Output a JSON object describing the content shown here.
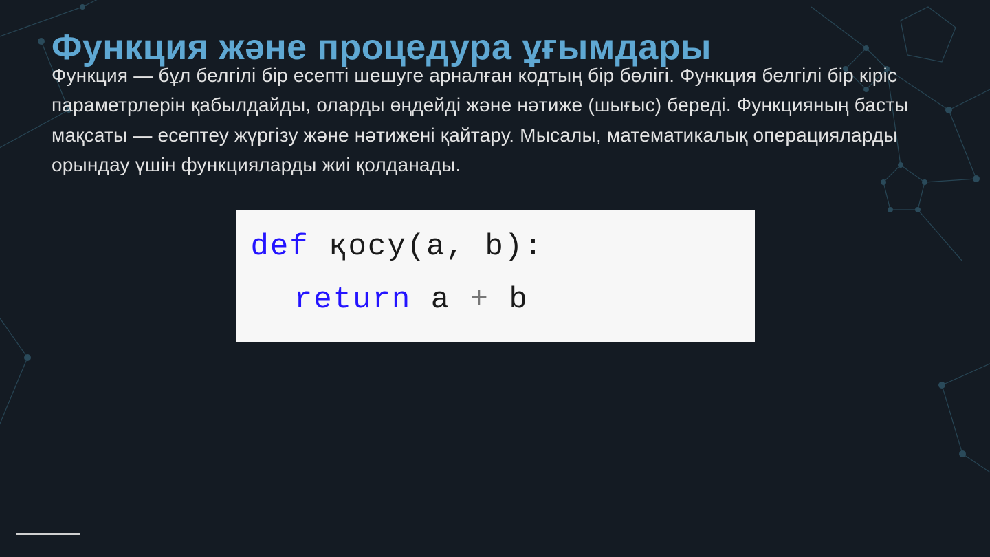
{
  "slide": {
    "title": "Функция және процедура ұғымдары",
    "body": "Функция — бұл белгілі бір есепті шешуге арналған кодтың бір бөлігі. Функция белгілі бір кіріс параметрлерін қабылдайды, оларды өңдейді және нәтиже (шығыс) береді. Функцияның басты мақсаты — есептеу жүргізу және нәтижені қайтару. Мысалы, математикалық операцияларды орындау үшін функцияларды жиі қолданады."
  },
  "code": {
    "kw_def": "def",
    "fn_name": "қосу",
    "open_paren": "(",
    "param_a": "a",
    "comma": ",",
    "param_b": "b",
    "close_paren": ")",
    "colon": ":",
    "kw_return": "return",
    "expr_a": "a",
    "plus": "+",
    "expr_b": "b"
  }
}
